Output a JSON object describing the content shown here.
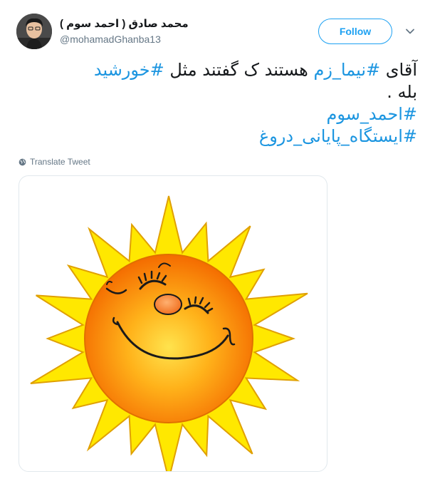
{
  "author": {
    "display_name": "محمد صادق ( احمد سوم )",
    "handle": "@mohamadGhanba13"
  },
  "follow_label": "Follow",
  "tweet": {
    "line1": {
      "prefix": "آقای ",
      "hashtag1": "#نیما_زم",
      "middle": " هستند ک گفتند مثل ",
      "hashtag2": "#خورشید"
    },
    "line2": "بله .",
    "hashtag3": "#احمد_سوم",
    "hashtag4": "#ایستگاه_پایانی_دروغ"
  },
  "translate_label": "Translate Tweet",
  "icons": {
    "more": "chevron-down-icon",
    "translate": "globe-icon"
  },
  "colors": {
    "accent": "#1da1f2",
    "hashtag": "#1b95e0",
    "sun_rays": "#ffe800",
    "sun_core": "#ff8a00"
  }
}
